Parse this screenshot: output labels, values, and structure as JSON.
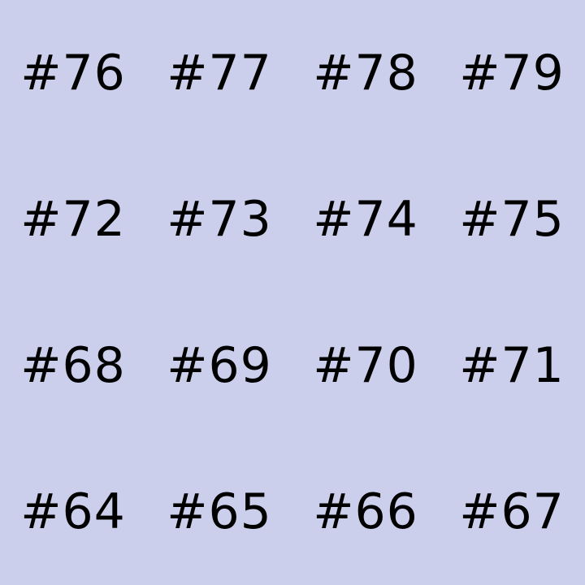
{
  "background_color": "#cbcfec",
  "text_color": "#000000",
  "rows": [
    [
      "#76",
      "#77",
      "#78",
      "#79"
    ],
    [
      "#72",
      "#73",
      "#74",
      "#75"
    ],
    [
      "#68",
      "#69",
      "#70",
      "#71"
    ],
    [
      "#64",
      "#65",
      "#66",
      "#67"
    ]
  ]
}
